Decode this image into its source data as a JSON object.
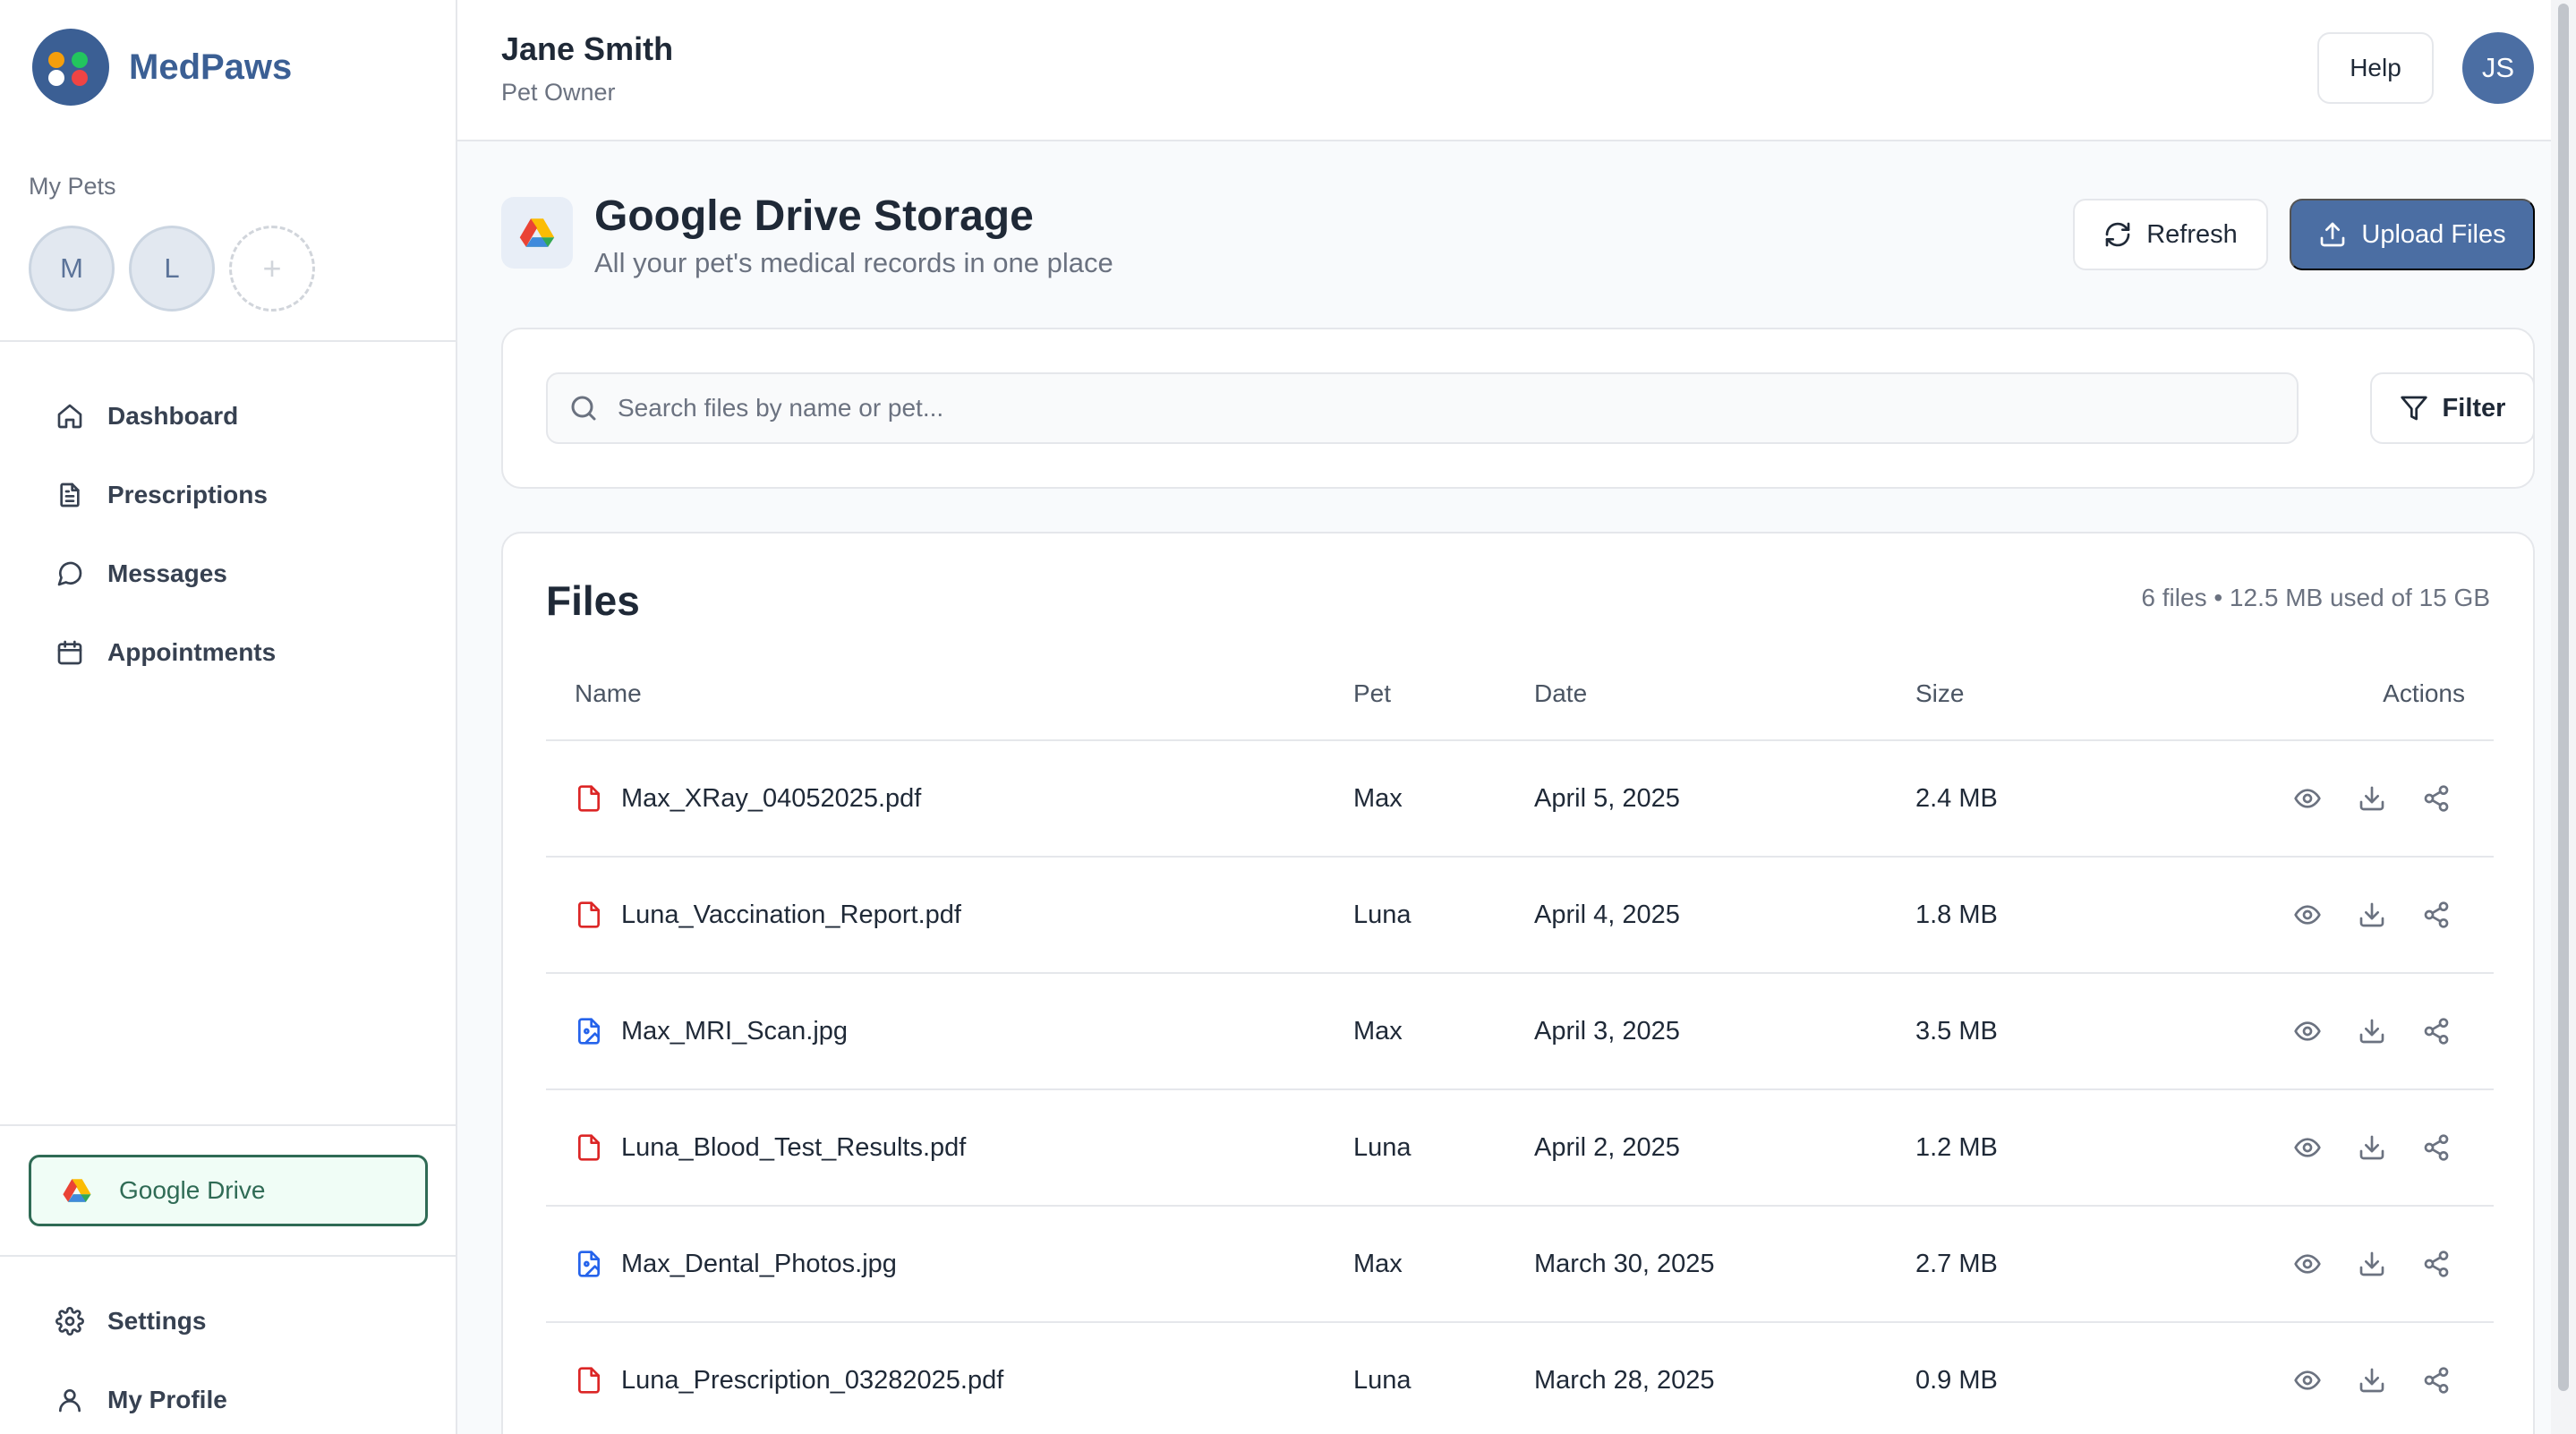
{
  "brand": {
    "name": "MedPaws"
  },
  "sidebar": {
    "pets_label": "My Pets",
    "pets": [
      {
        "initial": "M"
      },
      {
        "initial": "L"
      }
    ],
    "add_pet_symbol": "+",
    "nav": [
      {
        "label": "Dashboard",
        "icon": "home-icon"
      },
      {
        "label": "Prescriptions",
        "icon": "document-icon"
      },
      {
        "label": "Messages",
        "icon": "message-icon"
      },
      {
        "label": "Appointments",
        "icon": "calendar-icon"
      }
    ],
    "google_drive_label": "Google Drive",
    "bottom_nav": [
      {
        "label": "Settings",
        "icon": "gear-icon"
      },
      {
        "label": "My Profile",
        "icon": "user-icon"
      }
    ]
  },
  "header": {
    "user_name": "Jane Smith",
    "user_role": "Pet Owner",
    "help_label": "Help",
    "avatar_initials": "JS"
  },
  "storage": {
    "title": "Google Drive Storage",
    "subtitle": "All your pet's medical records in one place",
    "refresh_label": "Refresh",
    "upload_label": "Upload Files"
  },
  "search": {
    "placeholder": "Search files by name or pet...",
    "value": "",
    "filter_label": "Filter"
  },
  "files": {
    "title": "Files",
    "meta": "6 files • 12.5 MB used of 15 GB",
    "columns": {
      "name": "Name",
      "pet": "Pet",
      "date": "Date",
      "size": "Size",
      "actions": "Actions"
    },
    "rows": [
      {
        "name": "Max_XRay_04052025.pdf",
        "pet": "Max",
        "date": "April 5, 2025",
        "size": "2.4 MB",
        "type": "pdf"
      },
      {
        "name": "Luna_Vaccination_Report.pdf",
        "pet": "Luna",
        "date": "April 4, 2025",
        "size": "1.8 MB",
        "type": "pdf"
      },
      {
        "name": "Max_MRI_Scan.jpg",
        "pet": "Max",
        "date": "April 3, 2025",
        "size": "3.5 MB",
        "type": "image"
      },
      {
        "name": "Luna_Blood_Test_Results.pdf",
        "pet": "Luna",
        "date": "April 2, 2025",
        "size": "1.2 MB",
        "type": "pdf"
      },
      {
        "name": "Max_Dental_Photos.jpg",
        "pet": "Max",
        "date": "March 30, 2025",
        "size": "2.7 MB",
        "type": "image"
      },
      {
        "name": "Luna_Prescription_03282025.pdf",
        "pet": "Luna",
        "date": "March 28, 2025",
        "size": "0.9 MB",
        "type": "pdf"
      }
    ]
  },
  "colors": {
    "brand": "#3b5f94",
    "primary_button": "#4b6ea3",
    "pdf_icon": "#dc2626",
    "image_icon": "#2563eb",
    "drive_green": "#2f6b55"
  }
}
